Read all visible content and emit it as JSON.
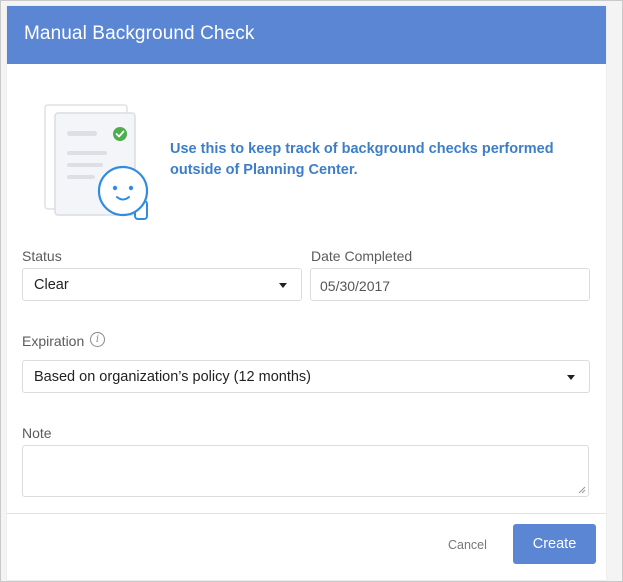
{
  "dialog": {
    "title": "Manual Background Check",
    "intro": "Use this to keep track of background checks performed outside of Planning Center."
  },
  "form": {
    "status": {
      "label": "Status",
      "value": "Clear"
    },
    "date_completed": {
      "label": "Date Completed",
      "value": "05/30/2017"
    },
    "expiration": {
      "label": "Expiration",
      "value": "Based on organization’s policy (12 months)"
    },
    "note": {
      "label": "Note",
      "value": ""
    }
  },
  "footer": {
    "cancel_label": "Cancel",
    "create_label": "Create"
  },
  "colors": {
    "header": "#5b86d4",
    "accent_text": "#3d7ec9",
    "primary_button": "#5b86d4",
    "check_badge": "#4cae4c"
  },
  "icons": [
    "document-illustration-icon",
    "smiley-face-icon",
    "check-badge-icon",
    "info-icon",
    "dropdown-caret-icon",
    "resize-handle-icon"
  ]
}
